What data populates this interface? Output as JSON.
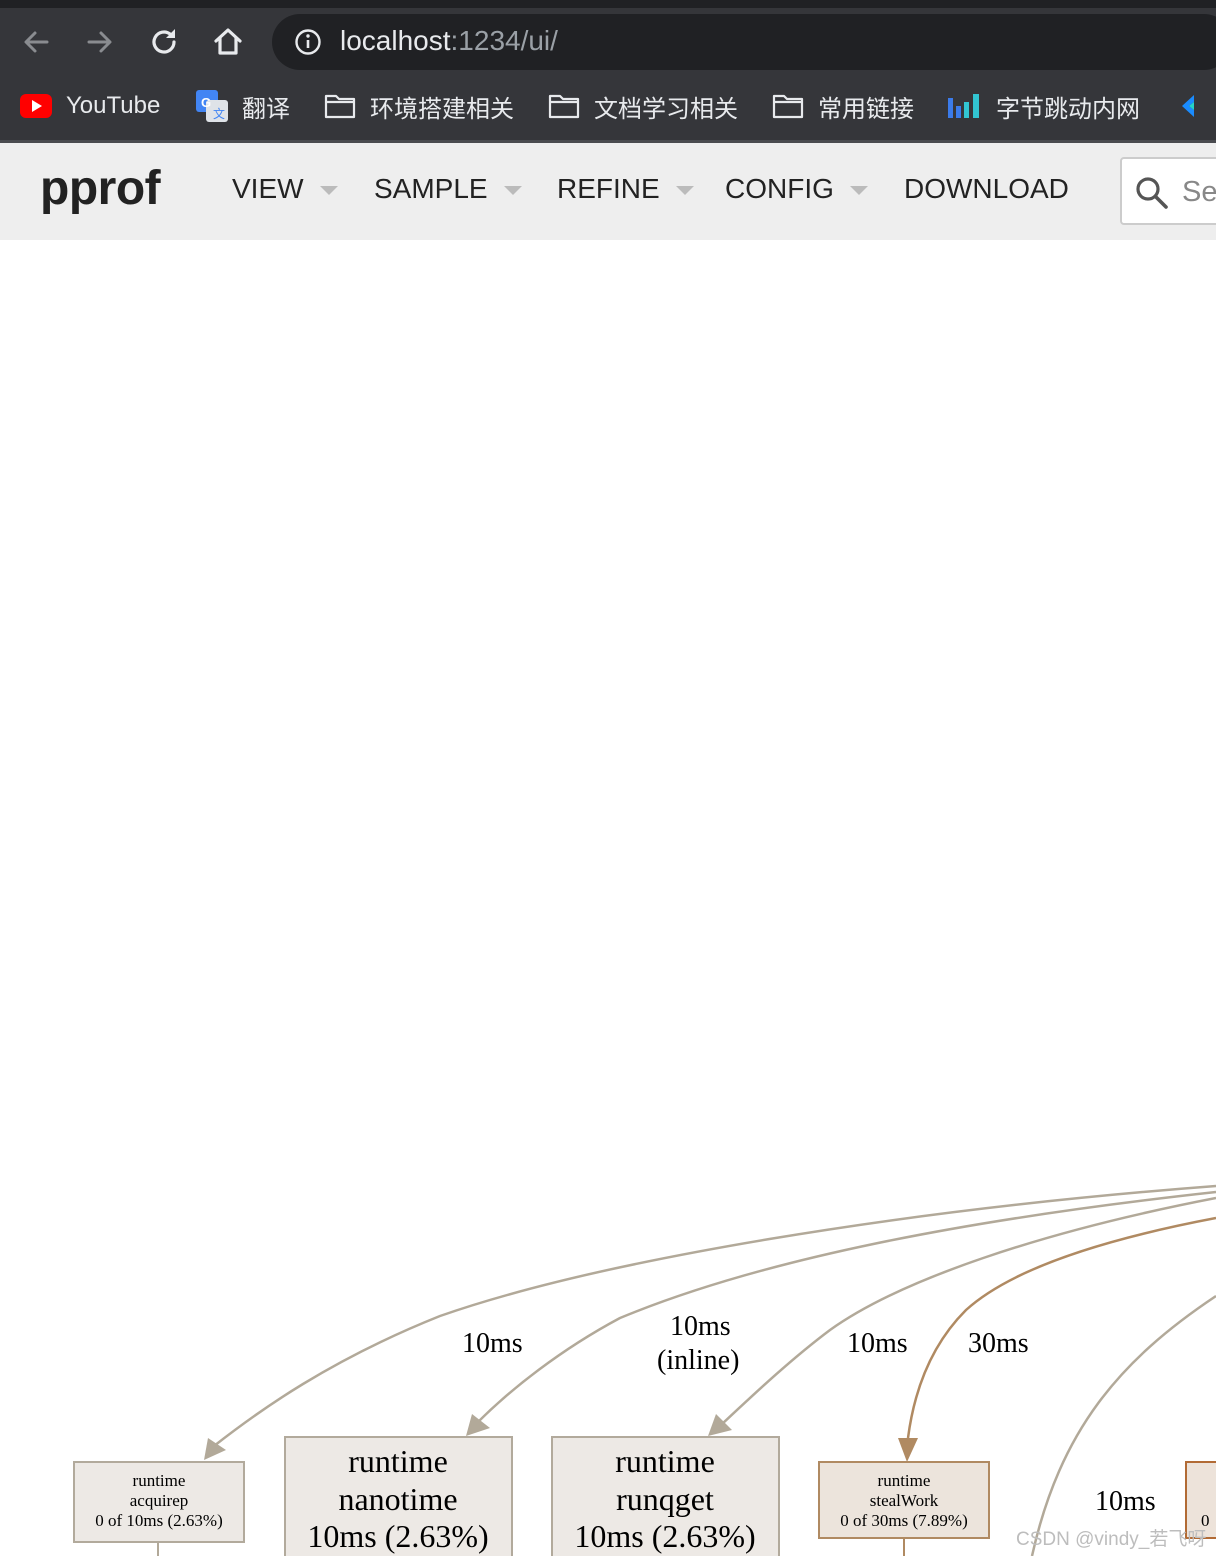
{
  "browser": {
    "url_host": "localhost",
    "url_path": ":1234/ui/",
    "bookmarks": [
      {
        "label": "YouTube",
        "icon": "youtube-icon"
      },
      {
        "label": "翻译",
        "icon": "google-translate-icon"
      },
      {
        "label": "环境搭建相关",
        "icon": "folder-icon"
      },
      {
        "label": "文档学习相关",
        "icon": "folder-icon"
      },
      {
        "label": "常用链接",
        "icon": "folder-icon"
      },
      {
        "label": "字节跳动内网",
        "icon": "bar-logo-icon"
      }
    ]
  },
  "pprof": {
    "logo": "pprof",
    "menus": [
      {
        "label": "VIEW",
        "has_dropdown": true
      },
      {
        "label": "SAMPLE",
        "has_dropdown": true
      },
      {
        "label": "REFINE",
        "has_dropdown": true
      },
      {
        "label": "CONFIG",
        "has_dropdown": true
      },
      {
        "label": "DOWNLOAD",
        "has_dropdown": false
      }
    ],
    "search_placeholder": "Se"
  },
  "graph": {
    "edge_labels": [
      {
        "text": "10ms"
      },
      {
        "text": "10ms",
        "text2": "(inline)"
      },
      {
        "text": "10ms"
      },
      {
        "text": "30ms"
      },
      {
        "text": "10ms"
      }
    ],
    "nodes": [
      {
        "line1": "runtime",
        "line2": "acquirep",
        "line3": "0 of 10ms (2.63%)"
      },
      {
        "line1": "runtime",
        "line2": "nanotime",
        "line3": "10ms (2.63%)"
      },
      {
        "line1": "runtime",
        "line2": "runqget",
        "line3": "10ms (2.63%)"
      },
      {
        "line1": "runtime",
        "line2": "stealWork",
        "line3": "0 of 30ms (7.89%)"
      },
      {
        "line1": "",
        "line2": "",
        "line3": "0"
      }
    ],
    "colors": {
      "edge_gray": "#b2a999",
      "edge_brown": "#b08a62",
      "node_fill": "#ede9e5",
      "node_stroke": "#b2aa9c",
      "node_brown_stroke": "#b08a62",
      "node_brown_fill": "#ece4dc",
      "node_orange_stroke": "#b26b35",
      "node_orange_fill": "#ede3da"
    }
  },
  "watermark": "CSDN @vindy_若飞呀"
}
